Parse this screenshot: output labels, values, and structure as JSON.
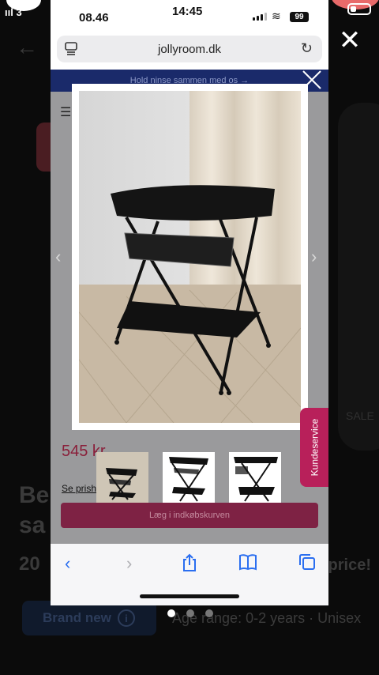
{
  "outer": {
    "bg_title": "Be sa",
    "bg_price": "20",
    "bg_price_right": "price!",
    "bg_brand": "Brand new",
    "bg_age": "Age range: 0-2 years · Unisex",
    "bg_sale": "SALE",
    "close_icon": "✕",
    "carrier": "3",
    "pager": {
      "count": 3,
      "active": 0
    }
  },
  "status": {
    "time_left": "08.46",
    "time_center": "14:45",
    "battery": "99"
  },
  "browser": {
    "domain": "jollyroom.dk"
  },
  "page": {
    "banner": "Hold ninse sammen med os →",
    "price": "545 kr",
    "price_link": "Se prishi...",
    "cart_button": "Læg i indkøbskurven",
    "customer_service": "Kundeservice"
  },
  "lightbox": {
    "image_alt": "Black folding changing table with mesh basket and lower shelf",
    "thumbnails": [
      "front view",
      "angled view",
      "side view with basket"
    ],
    "selected_thumbnail": 0
  },
  "colors": {
    "banner": "#1a2a6a",
    "price": "#8a1f3a",
    "cart": "#7e2244",
    "customer_service": "#b8205a",
    "ios_blue": "#2a6ef0"
  }
}
